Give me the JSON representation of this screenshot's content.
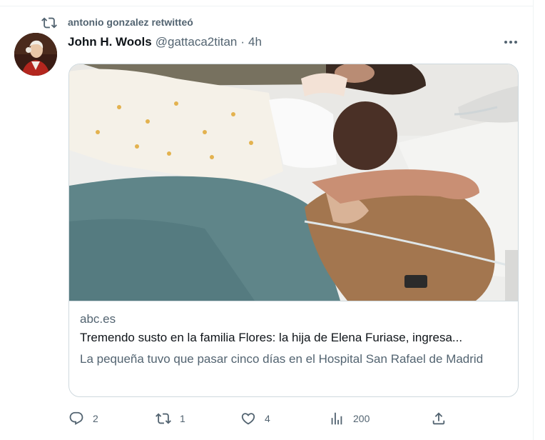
{
  "retweet": {
    "text": "antonio gonzalez retwitteó"
  },
  "tweet": {
    "author_name": "John H. Wools",
    "handle": "@gattaca2titan",
    "separator": "·",
    "time": "4h"
  },
  "card": {
    "domain": "abc.es",
    "title": "Tremendo susto en la familia Flores: la hija de Elena Furiase, ingresa...",
    "description": "La pequeña tuvo que pasar cinco días en el Hospital San Rafael de Madrid"
  },
  "actions": {
    "replies": "2",
    "retweets": "1",
    "likes": "4",
    "views": "200"
  },
  "icons": {
    "retweet_indicator": "retweet-icon",
    "more": "more-dots-icon",
    "reply": "reply-icon",
    "retweet": "retweet-icon",
    "like": "heart-icon",
    "views": "analytics-icon",
    "share": "share-icon"
  },
  "colors": {
    "secondary_text": "#536471",
    "primary_text": "#0f1419",
    "border": "#cfd9de"
  }
}
